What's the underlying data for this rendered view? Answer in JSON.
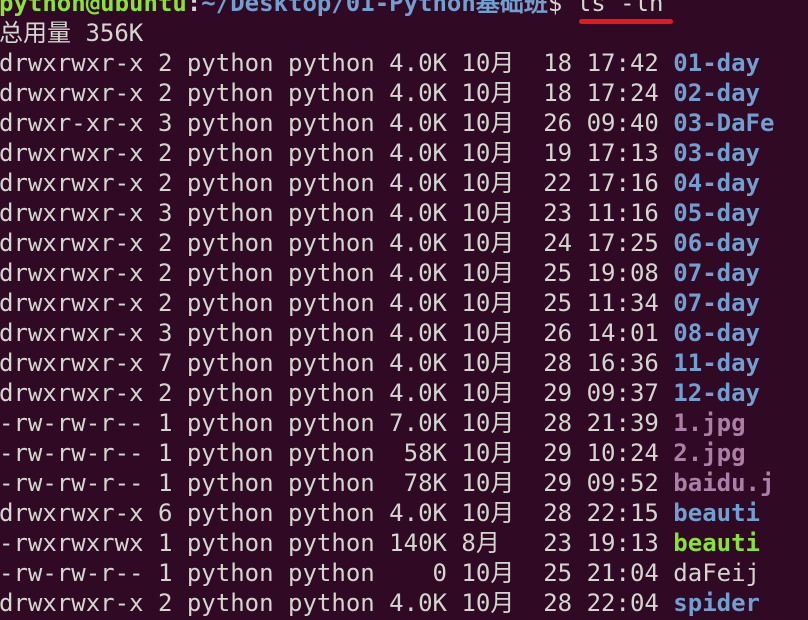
{
  "prompt": {
    "user_host": "python@ubuntu",
    "colon": ":",
    "path": "~/Desktop/01-Python基础班",
    "symbol": "$ ",
    "command": "ls -lh"
  },
  "total_line": "总用量 356K",
  "listing": [
    {
      "perms": "drwxrwxr-x",
      "links": "2",
      "owner": "python",
      "group": "python",
      "size": "4.0K",
      "month": "10月",
      "day": "18",
      "time": "17:42",
      "name": "01-day",
      "type": "dir"
    },
    {
      "perms": "drwxrwxr-x",
      "links": "2",
      "owner": "python",
      "group": "python",
      "size": "4.0K",
      "month": "10月",
      "day": "18",
      "time": "17:24",
      "name": "02-day",
      "type": "dir"
    },
    {
      "perms": "drwxr-xr-x",
      "links": "3",
      "owner": "python",
      "group": "python",
      "size": "4.0K",
      "month": "10月",
      "day": "26",
      "time": "09:40",
      "name": "03-DaFe",
      "type": "dir"
    },
    {
      "perms": "drwxrwxr-x",
      "links": "2",
      "owner": "python",
      "group": "python",
      "size": "4.0K",
      "month": "10月",
      "day": "19",
      "time": "17:13",
      "name": "03-day",
      "type": "dir"
    },
    {
      "perms": "drwxrwxr-x",
      "links": "2",
      "owner": "python",
      "group": "python",
      "size": "4.0K",
      "month": "10月",
      "day": "22",
      "time": "17:16",
      "name": "04-day",
      "type": "dir"
    },
    {
      "perms": "drwxrwxr-x",
      "links": "3",
      "owner": "python",
      "group": "python",
      "size": "4.0K",
      "month": "10月",
      "day": "23",
      "time": "11:16",
      "name": "05-day",
      "type": "dir"
    },
    {
      "perms": "drwxrwxr-x",
      "links": "2",
      "owner": "python",
      "group": "python",
      "size": "4.0K",
      "month": "10月",
      "day": "24",
      "time": "17:25",
      "name": "06-day",
      "type": "dir"
    },
    {
      "perms": "drwxrwxr-x",
      "links": "2",
      "owner": "python",
      "group": "python",
      "size": "4.0K",
      "month": "10月",
      "day": "25",
      "time": "19:08",
      "name": "07-day",
      "type": "dir"
    },
    {
      "perms": "drwxrwxr-x",
      "links": "2",
      "owner": "python",
      "group": "python",
      "size": "4.0K",
      "month": "10月",
      "day": "25",
      "time": "11:34",
      "name": "07-day",
      "type": "dir"
    },
    {
      "perms": "drwxrwxr-x",
      "links": "3",
      "owner": "python",
      "group": "python",
      "size": "4.0K",
      "month": "10月",
      "day": "26",
      "time": "14:01",
      "name": "08-day",
      "type": "dir"
    },
    {
      "perms": "drwxrwxr-x",
      "links": "7",
      "owner": "python",
      "group": "python",
      "size": "4.0K",
      "month": "10月",
      "day": "28",
      "time": "16:36",
      "name": "11-day",
      "type": "dir"
    },
    {
      "perms": "drwxrwxr-x",
      "links": "2",
      "owner": "python",
      "group": "python",
      "size": "4.0K",
      "month": "10月",
      "day": "29",
      "time": "09:37",
      "name": "12-day",
      "type": "dir"
    },
    {
      "perms": "-rw-rw-r--",
      "links": "1",
      "owner": "python",
      "group": "python",
      "size": "7.0K",
      "month": "10月",
      "day": "28",
      "time": "21:39",
      "name": "1.jpg",
      "type": "img"
    },
    {
      "perms": "-rw-rw-r--",
      "links": "1",
      "owner": "python",
      "group": "python",
      "size": " 58K",
      "month": "10月",
      "day": "29",
      "time": "10:24",
      "name": "2.jpg",
      "type": "img"
    },
    {
      "perms": "-rw-rw-r--",
      "links": "1",
      "owner": "python",
      "group": "python",
      "size": " 78K",
      "month": "10月",
      "day": "29",
      "time": "09:52",
      "name": "baidu.j",
      "type": "img"
    },
    {
      "perms": "drwxrwxr-x",
      "links": "6",
      "owner": "python",
      "group": "python",
      "size": "4.0K",
      "month": "10月",
      "day": "28",
      "time": "22:15",
      "name": "beauti",
      "type": "dir"
    },
    {
      "perms": "-rwxrwxrwx",
      "links": "1",
      "owner": "python",
      "group": "python",
      "size": "140K",
      "month": "8月 ",
      "day": "23",
      "time": "19:13",
      "name": "beauti",
      "type": "exec"
    },
    {
      "perms": "-rw-rw-r--",
      "links": "1",
      "owner": "python",
      "group": "python",
      "size": "   0",
      "month": "10月",
      "day": "25",
      "time": "21:04",
      "name": "daFeij",
      "type": "file"
    },
    {
      "perms": "drwxrwxr-x",
      "links": "2",
      "owner": "python",
      "group": "python",
      "size": "4.0K",
      "month": "10月",
      "day": "28",
      "time": "22:04",
      "name": "spider",
      "type": "dir"
    }
  ],
  "colors": {
    "background": "#300a24",
    "text": "#d3d7cf",
    "prompt_user": "#8ae234",
    "prompt_path": "#729fcf",
    "directory": "#729fcf",
    "image": "#ad7fa8",
    "executable": "#8ae234",
    "annotation_underline": "#e3191b"
  }
}
